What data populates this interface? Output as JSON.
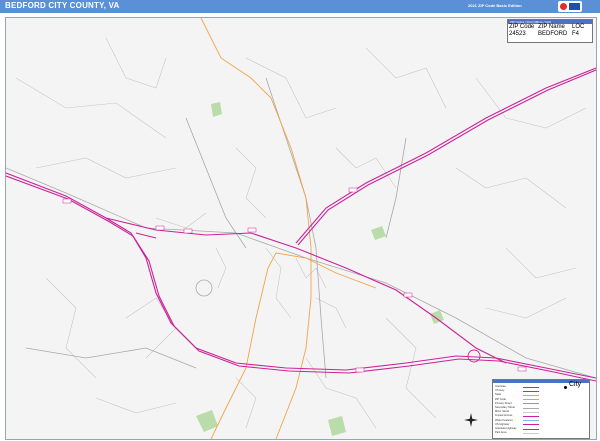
{
  "header": {
    "title": "BEDFORD CITY COUNTY, VA",
    "edition": "2021 ZIP Code Basic Edition"
  },
  "zip_table": {
    "caption": "ZIP Codes / Post Offices / Grid",
    "columns": [
      "ZIP Code",
      "ZIP Name",
      "LOC"
    ],
    "rows": [
      [
        "24523",
        "BEDFORD",
        "F4"
      ]
    ]
  },
  "legend": {
    "city_label": "City",
    "items": [
      {
        "label": "Interstate",
        "color": "#cc2299"
      },
      {
        "label": "US Hwy",
        "color": "#cc2299"
      },
      {
        "label": "State",
        "color": "#f2a34a"
      },
      {
        "label": "ZIP Code",
        "color": "#7fb8e0"
      },
      {
        "label": "Primary Street",
        "color": "#999999"
      },
      {
        "label": "Secondary Street",
        "color": "#aaaaaa"
      },
      {
        "label": "Minor Street",
        "color": "#cccccc"
      },
      {
        "label": "Limited Access",
        "color": "#cc2299"
      },
      {
        "label": "Water Features",
        "color": "#7fb8e0"
      },
      {
        "label": "US Highway",
        "color": "#cc2299"
      },
      {
        "label": "Interstate Highway",
        "color": "#cc2299"
      },
      {
        "label": "Park Area",
        "color": "#b9dcaa"
      }
    ]
  },
  "colors": {
    "header": "#5b8fd6",
    "interstate": "#cc2299",
    "state_route": "#f2a34a",
    "street": "#b4b4b4",
    "park": "#b9dcaa"
  },
  "icons": {
    "compass": "compass-icon",
    "logo": "market-maps-logo"
  }
}
